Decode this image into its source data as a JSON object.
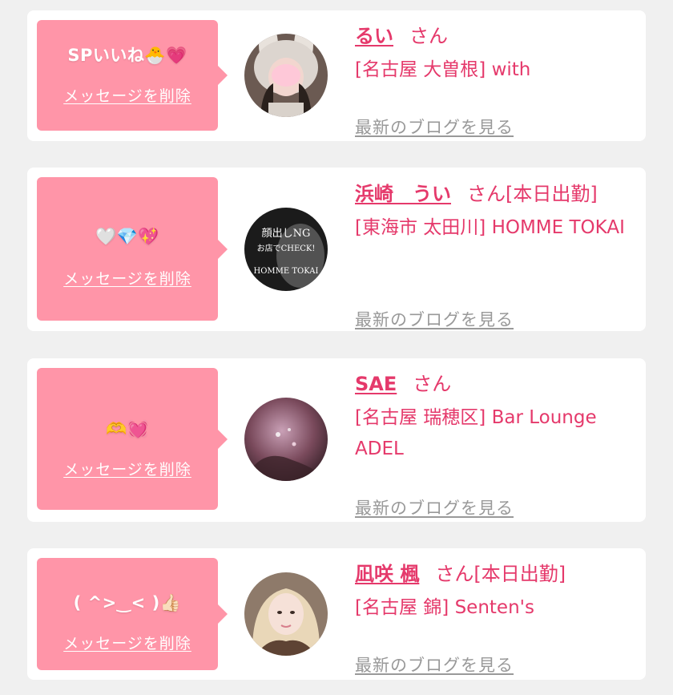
{
  "colors": {
    "bubble": "#ff95a8",
    "accent": "#e5396b",
    "muted_link": "#999999",
    "background": "#f0f0f0"
  },
  "cards": [
    {
      "message": "SPいいね🐣💗",
      "delete_label": "メッセージを削除",
      "name": "るい",
      "san": "さん",
      "status": "",
      "shop": "[名古屋 大曽根] with",
      "blog_label": "最新のブログを見る"
    },
    {
      "message": "🤍💎💖",
      "delete_label": "メッセージを削除",
      "name": "浜崎　うい",
      "san": "さん",
      "status": "[本日出勤]",
      "shop": "[東海市 太田川] HOMME TOKAI",
      "blog_label": "最新のブログを見る",
      "avatar_text": {
        "line1": "顔出しNG",
        "line2": "お店でCHECK!",
        "line3": "HOMME TOKAI"
      }
    },
    {
      "message": "🫶💓",
      "delete_label": "メッセージを削除",
      "name": "SAE",
      "san": "さん",
      "status": "",
      "shop": "[名古屋 瑞穂区] Bar Lounge ADEL",
      "blog_label": "最新のブログを見る"
    },
    {
      "message": "( ^>‿< )👍🏻",
      "delete_label": "メッセージを削除",
      "name": "凪咲 楓",
      "san": "さん",
      "status": "[本日出勤]",
      "shop": "[名古屋 錦] Senten's",
      "blog_label": "最新のブログを見る"
    }
  ]
}
